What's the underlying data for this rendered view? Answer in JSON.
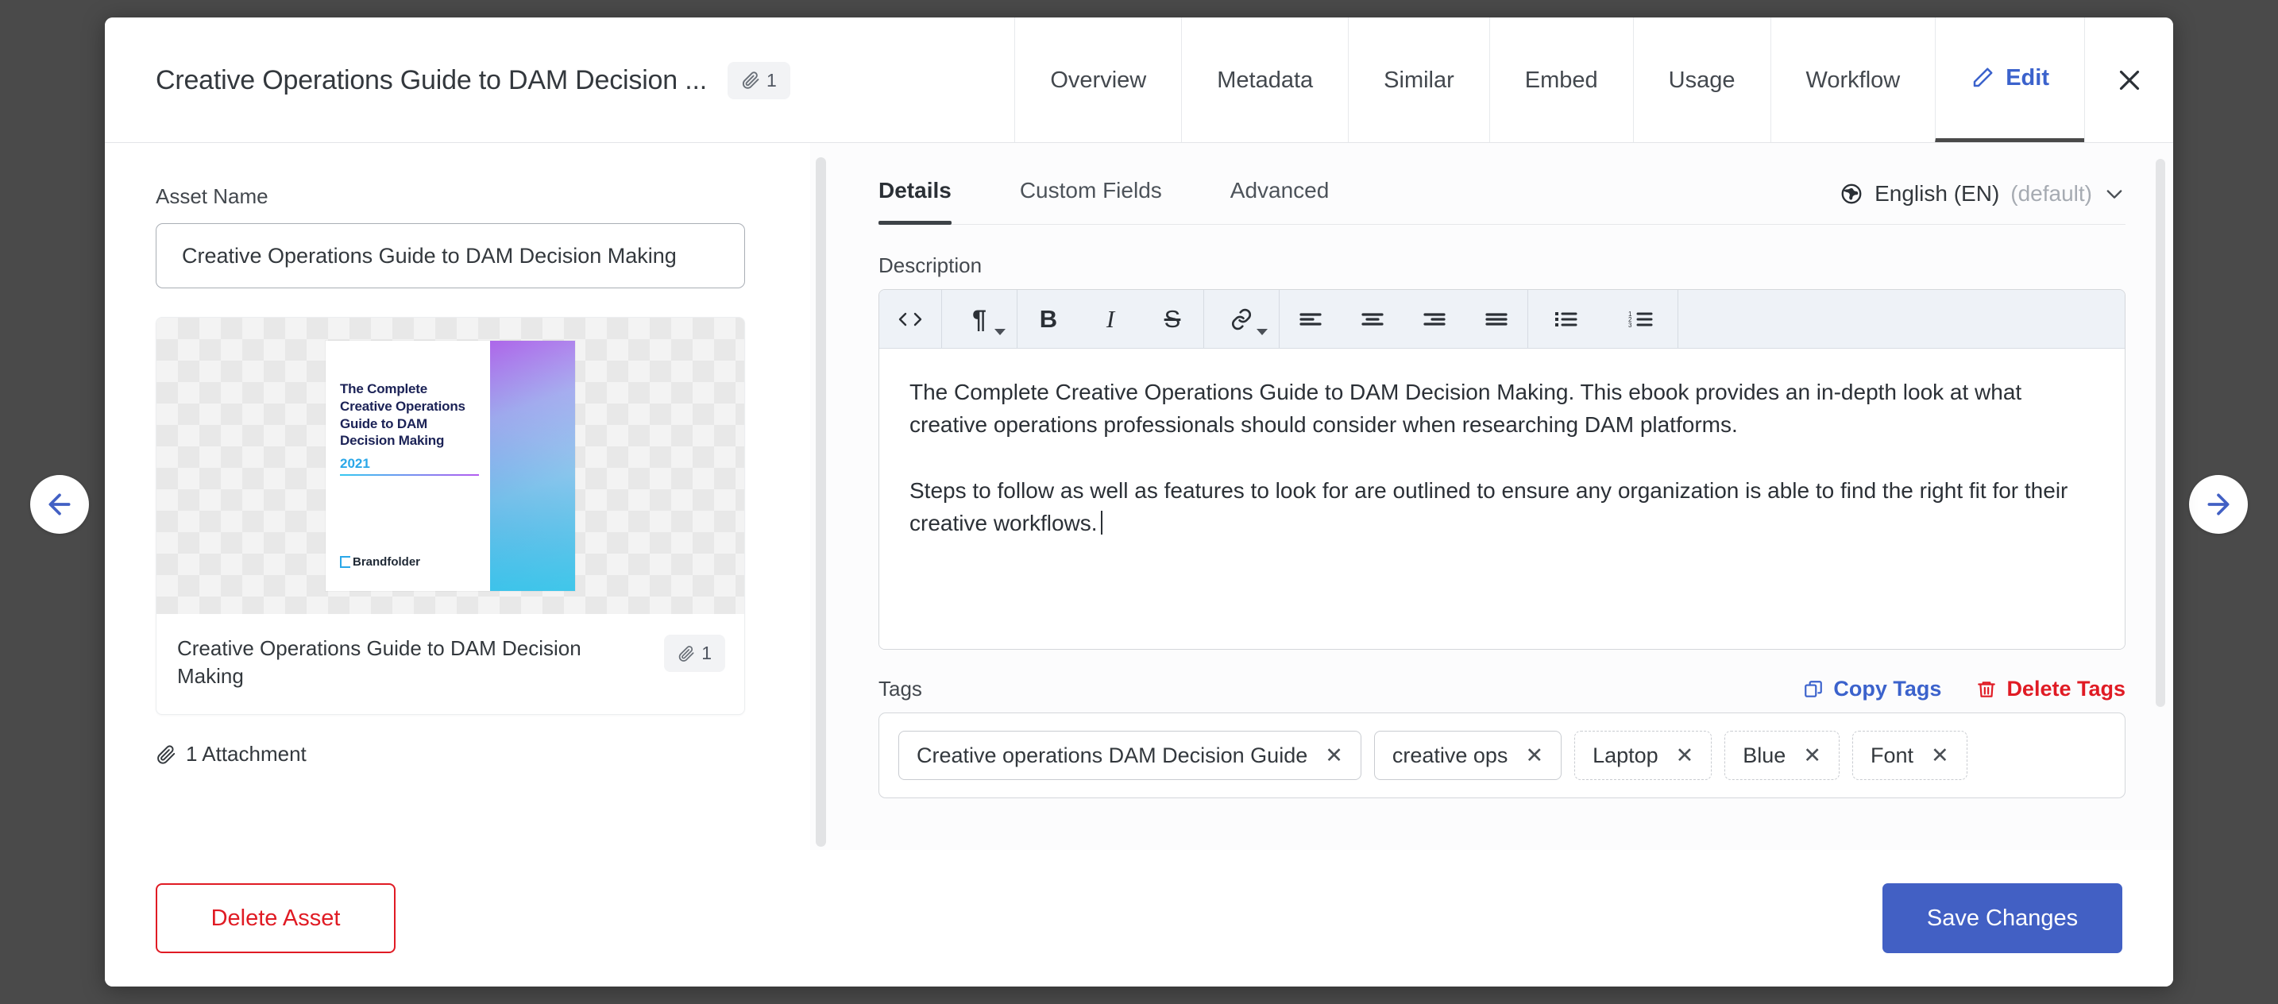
{
  "header": {
    "title": "Creative Operations Guide to DAM Decision ...",
    "attachment_count": "1",
    "attachment_icon": "paperclip-icon",
    "close_icon": "close-icon",
    "tabs": [
      {
        "label": "Overview",
        "active": false
      },
      {
        "label": "Metadata",
        "active": false
      },
      {
        "label": "Similar",
        "active": false
      },
      {
        "label": "Embed",
        "active": false
      },
      {
        "label": "Usage",
        "active": false
      },
      {
        "label": "Workflow",
        "active": false
      },
      {
        "label": "Edit",
        "active": true,
        "icon": "pencil-icon"
      }
    ]
  },
  "left": {
    "asset_name_label": "Asset Name",
    "asset_name_value": "Creative Operations Guide to DAM Decision Making",
    "asset_name_placeholder": "Asset Name",
    "card": {
      "caption": "Creative Operations Guide to DAM Decision Making",
      "attachment_count": "1",
      "cover": {
        "title": "The Complete Creative Operations Guide to DAM Decision Making",
        "year": "2021",
        "brand": "Brandfolder"
      }
    },
    "attachment_line": "1 Attachment"
  },
  "right": {
    "subtabs": [
      {
        "label": "Details",
        "active": true
      },
      {
        "label": "Custom Fields",
        "active": false
      },
      {
        "label": "Advanced",
        "active": false
      }
    ],
    "language": {
      "icon": "globe-icon",
      "name": "English (EN)",
      "default_suffix": "(default)",
      "chevron": "chevron-down-icon"
    },
    "description_label": "Description",
    "toolbar": [
      {
        "name": "code-icon",
        "glyph": "<>",
        "caret": false
      },
      {
        "name": "paragraph-format-icon",
        "glyph": "¶",
        "caret": true
      },
      {
        "name": "bold-icon",
        "glyph": "B",
        "caret": false
      },
      {
        "name": "italic-icon",
        "glyph": "I",
        "caret": false
      },
      {
        "name": "strikethrough-icon",
        "glyph": "S",
        "caret": false
      },
      {
        "name": "link-icon",
        "glyph": "link",
        "caret": true
      },
      {
        "name": "align-left-icon",
        "glyph": "align-left",
        "caret": false
      },
      {
        "name": "align-center-icon",
        "glyph": "align-center",
        "caret": false
      },
      {
        "name": "align-right-icon",
        "glyph": "align-right",
        "caret": false
      },
      {
        "name": "align-justify-icon",
        "glyph": "align-justify",
        "caret": false
      },
      {
        "name": "bulleted-list-icon",
        "glyph": "ul",
        "caret": false
      },
      {
        "name": "numbered-list-icon",
        "glyph": "ol",
        "caret": false
      }
    ],
    "description_paragraph_1": "The Complete Creative Operations Guide to DAM Decision Making. This ebook provides an in-depth look at what creative operations professionals should consider when researching DAM platforms.",
    "description_paragraph_2": "Steps to follow as well as features to look for are outlined to ensure any organization is able to find the right fit for their creative workflows.",
    "tags_label": "Tags",
    "copy_tags_label": "Copy Tags",
    "delete_tags_label": "Delete Tags",
    "copy_tags_icon": "copy-icon",
    "delete_tags_icon": "trash-icon",
    "tags": [
      {
        "label": "Creative operations DAM Decision Guide",
        "auto": false
      },
      {
        "label": "creative ops",
        "auto": false
      },
      {
        "label": "Laptop",
        "auto": true
      },
      {
        "label": "Blue",
        "auto": true
      },
      {
        "label": "Font",
        "auto": true
      }
    ]
  },
  "footer": {
    "delete_asset_label": "Delete Asset",
    "save_changes_label": "Save Changes"
  },
  "nav": {
    "prev_icon": "arrow-left-icon",
    "next_icon": "arrow-right-icon"
  },
  "colors": {
    "accent_blue": "#4260c4",
    "link_blue": "#3b62cc",
    "danger_red": "#e01b24",
    "backdrop": "#4a4a4a"
  }
}
